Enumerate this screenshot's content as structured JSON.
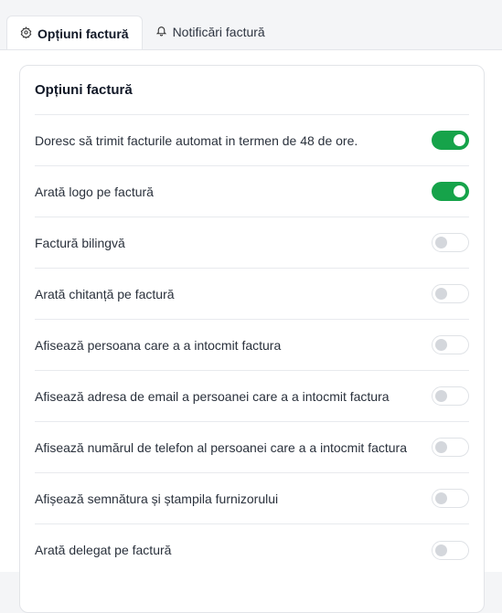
{
  "tabs": [
    {
      "label": "Opțiuni factură",
      "icon": "gear-icon",
      "active": true
    },
    {
      "label": "Notificări factură",
      "icon": "bell-icon",
      "active": false
    }
  ],
  "card": {
    "title": "Opțiuni factură",
    "options": [
      {
        "label": "Doresc să trimit facturile automat in termen de 48 de ore.",
        "enabled": true
      },
      {
        "label": "Arată logo pe factură",
        "enabled": true
      },
      {
        "label": "Factură bilingvă",
        "enabled": false
      },
      {
        "label": "Arată chitanță pe factură",
        "enabled": false
      },
      {
        "label": "Afisează persoana care a a intocmit factura",
        "enabled": false
      },
      {
        "label": "Afisează adresa de email a persoanei care a a intocmit factura",
        "enabled": false
      },
      {
        "label": "Afisează numărul de telefon al persoanei care a a intocmit factura",
        "enabled": false
      },
      {
        "label": "Afișează semnătura și ștampila furnizorului",
        "enabled": false
      },
      {
        "label": "Arată delegat pe factură",
        "enabled": false
      }
    ]
  },
  "colors": {
    "toggle_on": "#16a34a",
    "toggle_off_knob": "#d4d7dc"
  }
}
